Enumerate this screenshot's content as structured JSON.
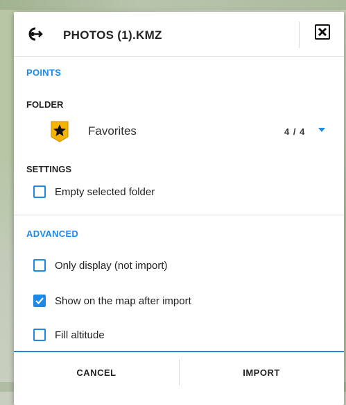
{
  "dialog": {
    "title": "PHOTOS (1).KMZ",
    "header_icon": "import-icon",
    "close_icon": "close-icon"
  },
  "points": {
    "section_label": "POINTS",
    "folder_label": "FOLDER",
    "folder": {
      "name": "Favorites",
      "icon": "star-folder-icon",
      "count": "4 / 4"
    },
    "settings_label": "SETTINGS",
    "empty_folder": {
      "label": "Empty selected folder",
      "checked": false
    }
  },
  "advanced": {
    "section_label": "ADVANCED",
    "options": [
      {
        "label": "Only display (not import)",
        "checked": false
      },
      {
        "label": "Show on the map after import",
        "checked": true
      },
      {
        "label": "Fill altitude",
        "checked": false
      }
    ]
  },
  "footer": {
    "cancel_label": "CANCEL",
    "import_label": "IMPORT"
  },
  "colors": {
    "accent": "#1e88e5",
    "folder_icon_fill": "#f5b400"
  }
}
